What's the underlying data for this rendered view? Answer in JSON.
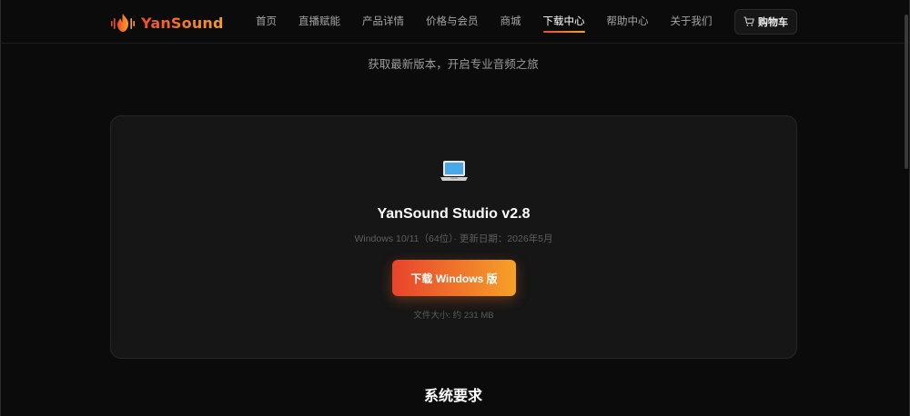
{
  "brand": {
    "name": "YanSound",
    "logo_icon": "flame-soundwave-icon"
  },
  "nav": {
    "items": [
      {
        "label": "首页",
        "active": false
      },
      {
        "label": "直播赋能",
        "active": false
      },
      {
        "label": "产品详情",
        "active": false
      },
      {
        "label": "价格与会员",
        "active": false
      },
      {
        "label": "商城",
        "active": false
      },
      {
        "label": "下载中心",
        "active": true
      },
      {
        "label": "帮助中心",
        "active": false
      },
      {
        "label": "关于我们",
        "active": false
      }
    ]
  },
  "cart": {
    "label": "购物车",
    "icon": "cart-icon"
  },
  "page": {
    "subtitle": "获取最新版本，开启专业音频之旅"
  },
  "download_card": {
    "icon": "laptop-icon",
    "title": "YanSound Studio v2.8",
    "meta": "Windows 10/11（64位）· 更新日期：2026年5月",
    "button_label": "下载 Windows 版",
    "file_size": "文件大小: 约 231 MB"
  },
  "requirements": {
    "title": "系统要求"
  },
  "colors": {
    "accent_start": "#e8432d",
    "accent_end": "#f6a128",
    "background": "#0b0b0b",
    "card": "#161616"
  }
}
